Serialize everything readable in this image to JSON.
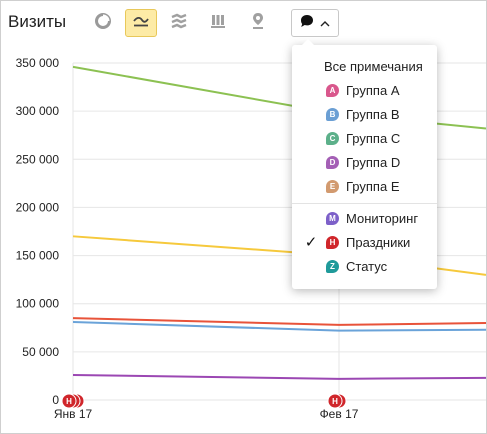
{
  "header": {
    "title": "Визиты"
  },
  "toolbar": {
    "buttons": [
      {
        "icon": "pie-chart-icon",
        "active": false
      },
      {
        "icon": "line-chart-icon",
        "active": true
      },
      {
        "icon": "stacked-area-icon",
        "active": false
      },
      {
        "icon": "bar-chart-icon",
        "active": false
      },
      {
        "icon": "map-pin-icon",
        "active": false
      }
    ],
    "notes_button": {
      "icon": "speech-bubble-icon",
      "chevron": "chevron-up-icon"
    }
  },
  "notes_menu": {
    "all_label": "Все примечания",
    "groups": [
      {
        "letter": "A",
        "label": "Группа A",
        "color": "#d9578c",
        "checked": false
      },
      {
        "letter": "B",
        "label": "Группа B",
        "color": "#6b9fd4",
        "checked": false
      },
      {
        "letter": "C",
        "label": "Группа C",
        "color": "#5cb08a",
        "checked": false
      },
      {
        "letter": "D",
        "label": "Группа D",
        "color": "#a45fb5",
        "checked": false
      },
      {
        "letter": "E",
        "label": "Группа E",
        "color": "#d29a6f",
        "checked": false
      }
    ],
    "categories": [
      {
        "letter": "M",
        "label": "Мониторинг",
        "color": "#7d60c9",
        "checked": false
      },
      {
        "letter": "H",
        "label": "Праздники",
        "color": "#d0262b",
        "checked": true
      },
      {
        "letter": "Z",
        "label": "Статус",
        "color": "#1f9a9a",
        "checked": false
      }
    ],
    "check_glyph": "✓"
  },
  "chart_data": {
    "type": "line",
    "x": [
      "Янв 17",
      "Фев 17",
      ""
    ],
    "x_tick_labels": [
      "Янв 17",
      "Фев 17"
    ],
    "y_tick_labels": [
      "0",
      "50 000",
      "100 000",
      "150 000",
      "200 000",
      "250 000",
      "300 000",
      "350 000"
    ],
    "ylim": [
      0,
      355000
    ],
    "grid": true,
    "series": [
      {
        "color": "#8cc152",
        "values": [
          346000,
          297000,
          282000
        ]
      },
      {
        "color": "#f6c93c",
        "values": [
          170000,
          150000,
          130000
        ]
      },
      {
        "color": "#e8533a",
        "values": [
          85000,
          78000,
          80000
        ]
      },
      {
        "color": "#6aa3d9",
        "values": [
          81000,
          72000,
          73000
        ]
      },
      {
        "color": "#9b47b3",
        "values": [
          26000,
          22000,
          23000
        ]
      }
    ],
    "annotations": [
      {
        "x": "Янв 17",
        "letter": "H",
        "count": 3,
        "color": "#d0262b"
      },
      {
        "x": "Фев 17",
        "letter": "H",
        "count": 2,
        "color": "#d0262b"
      }
    ]
  }
}
